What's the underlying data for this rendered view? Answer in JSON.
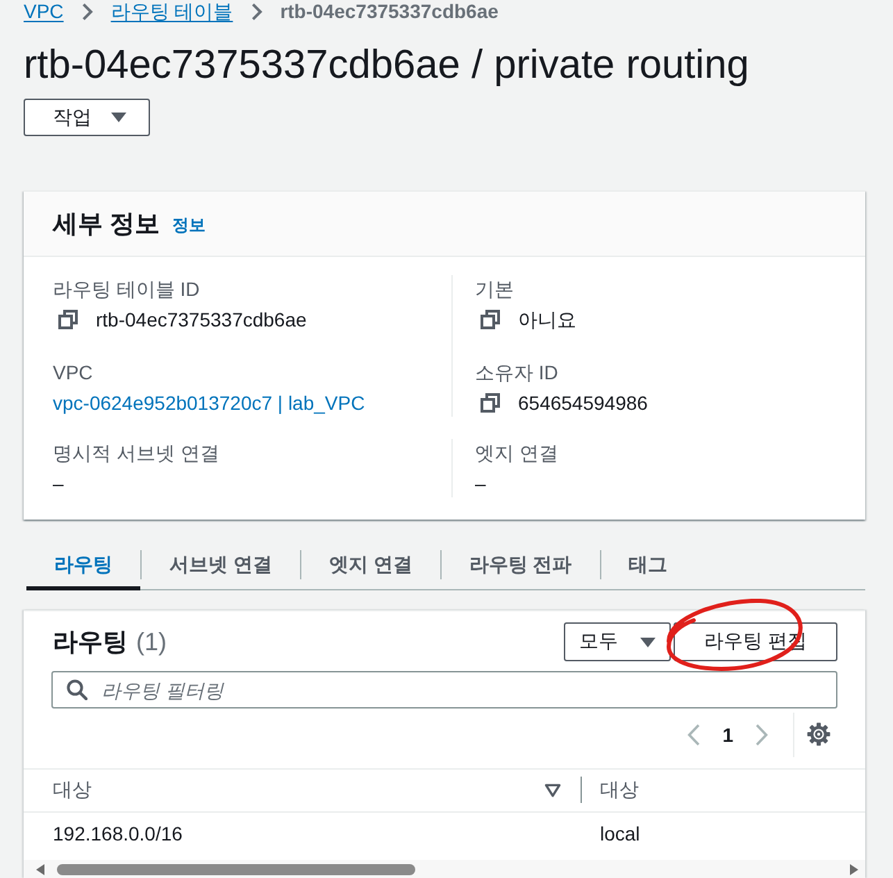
{
  "breadcrumb": [
    {
      "label": "VPC",
      "kind": "link"
    },
    {
      "label": "라우팅 테이블",
      "kind": "link"
    },
    {
      "label": "rtb-04ec7375337cdb6ae",
      "kind": "current"
    }
  ],
  "title": "rtb-04ec7375337cdb6ae / private routing",
  "actions_button": {
    "label": "작업"
  },
  "details": {
    "heading": "세부 정보",
    "info_link": "정보",
    "sections": [
      {
        "columns": [
          [
            {
              "label": "라우팅 테이블 ID",
              "value": "rtb-04ec7375337cdb6ae",
              "kind": "copy"
            },
            {
              "label": "VPC",
              "value": "vpc-0624e952b013720c7 | lab_VPC",
              "kind": "link"
            }
          ],
          [
            {
              "label": "기본",
              "value": "아니요",
              "kind": "copy"
            },
            {
              "label": "소유자 ID",
              "value": "654654594986",
              "kind": "copy"
            }
          ]
        ]
      },
      {
        "columns": [
          [
            {
              "label": "명시적 서브넷 연결",
              "value": "–",
              "kind": "text"
            }
          ],
          [
            {
              "label": "엣지 연결",
              "value": "–",
              "kind": "text"
            }
          ]
        ]
      }
    ]
  },
  "tabs": [
    {
      "label": "라우팅",
      "selected": true
    },
    {
      "label": "서브넷 연결",
      "selected": false
    },
    {
      "label": "엣지 연결",
      "selected": false
    },
    {
      "label": "라우팅 전파",
      "selected": false
    },
    {
      "label": "태그",
      "selected": false
    }
  ],
  "routes": {
    "heading": "라우팅",
    "count": "(1)",
    "filter_dropdown": {
      "label": "모두"
    },
    "edit_button": {
      "label": "라우팅 편집"
    },
    "search": {
      "placeholder": "라우팅 필터링"
    },
    "pagination": {
      "previous": {
        "disabled": true
      },
      "page": "1",
      "next": {
        "disabled": true
      }
    },
    "table": {
      "columns": [
        {
          "label": "대상",
          "sortable": true
        },
        {
          "label": "대상",
          "sortable": false
        }
      ],
      "rows": [
        [
          "192.168.0.0/16",
          "local"
        ]
      ]
    }
  }
}
